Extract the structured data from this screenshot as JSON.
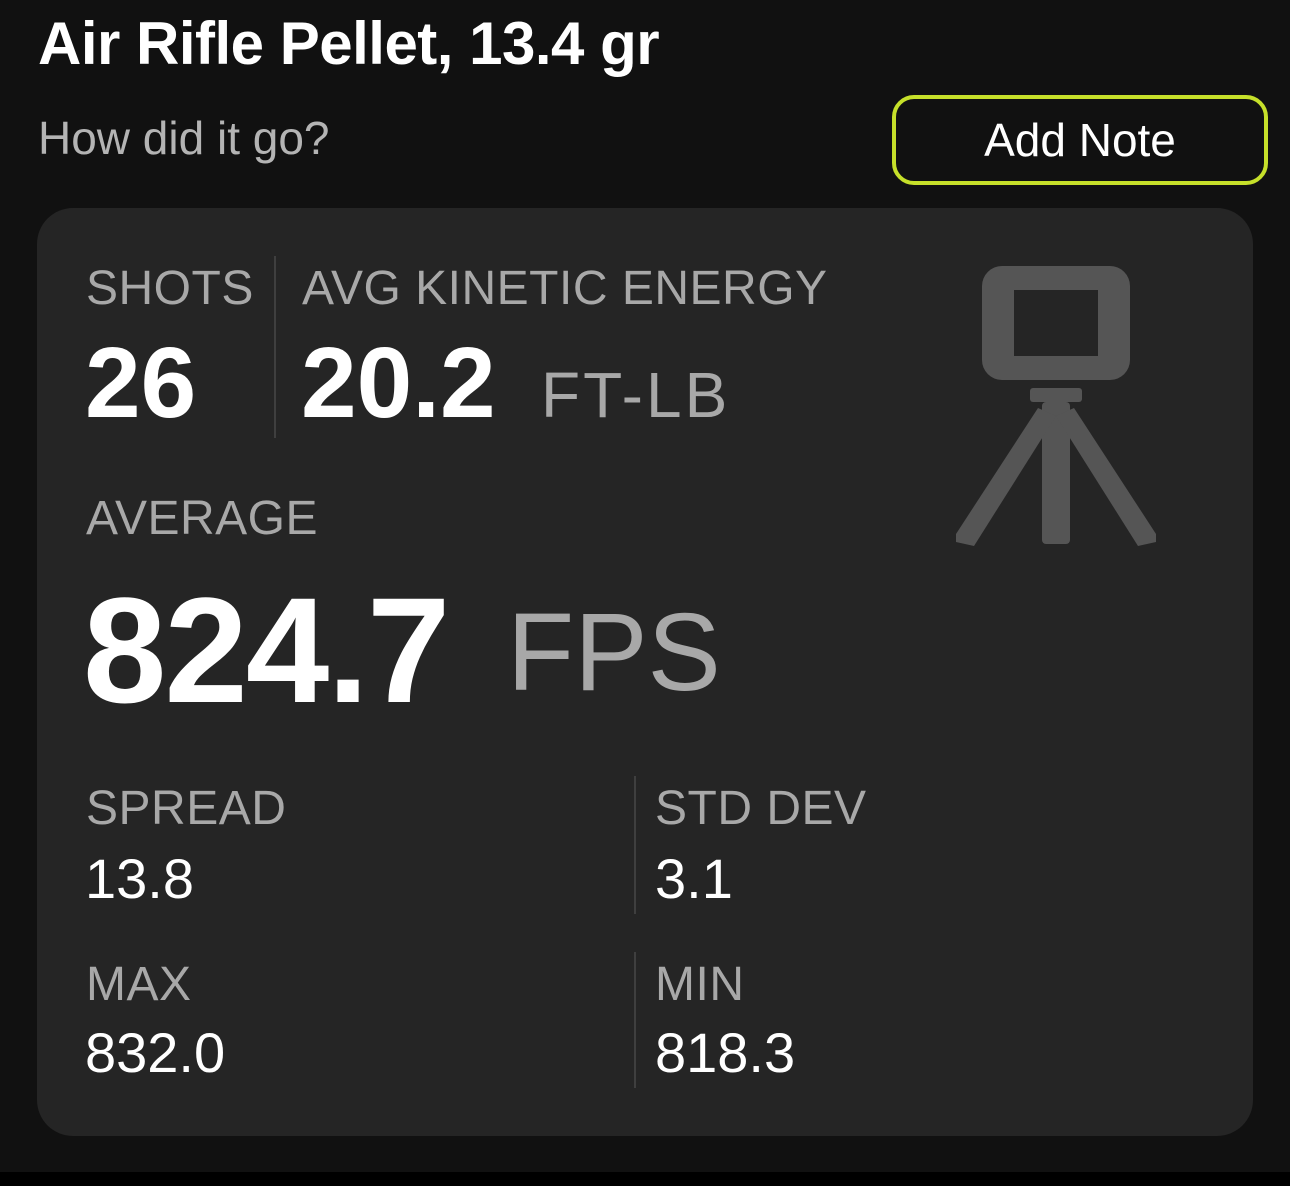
{
  "header": {
    "title": "Air Rifle Pellet, 13.4 gr",
    "prompt": "How did it go?",
    "add_note_label": "Add Note"
  },
  "summary": {
    "shots": {
      "label": "SHOTS",
      "value": "26"
    },
    "avg_kinetic_energy": {
      "label": "AVG KINETIC ENERGY",
      "value": "20.2",
      "unit": "FT-LB"
    },
    "average": {
      "label": "AVERAGE",
      "value": "824.7",
      "unit": "FPS"
    },
    "spread": {
      "label": "SPREAD",
      "value": "13.8"
    },
    "std_dev": {
      "label": "STD DEV",
      "value": "3.1"
    },
    "max": {
      "label": "MAX",
      "value": "832.0"
    },
    "min": {
      "label": "MIN",
      "value": "818.3"
    },
    "device_icon": "chronograph-tripod-icon"
  },
  "colors": {
    "background": "#111111",
    "card": "#252525",
    "accent": "#c6e02a",
    "text_primary": "#ffffff",
    "text_secondary": "#a8a8a8",
    "icon": "#555555"
  }
}
